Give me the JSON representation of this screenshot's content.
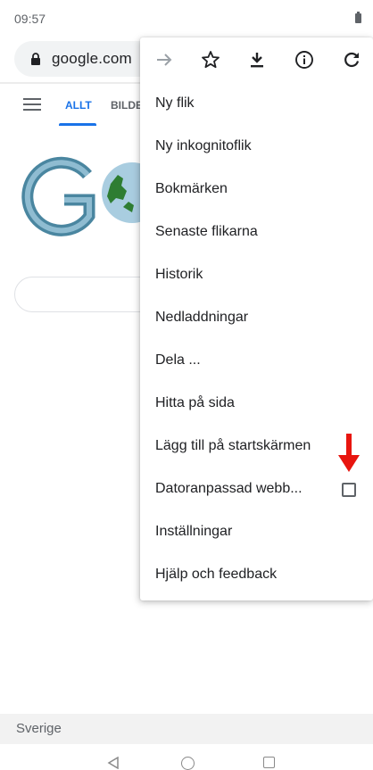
{
  "status_bar": {
    "time": "09:57"
  },
  "url_bar": {
    "url": "google.com"
  },
  "google_page": {
    "tabs": [
      {
        "label": "ALLT",
        "active": true
      },
      {
        "label": "BILDE"
      }
    ],
    "footer_country": "Sverige"
  },
  "overflow_menu": {
    "icon_row": [
      "forward-arrow-icon",
      "star-icon",
      "download-icon",
      "info-icon",
      "refresh-icon"
    ],
    "items": [
      {
        "label": "Ny flik"
      },
      {
        "label": "Ny inkognitoflik"
      },
      {
        "label": "Bokmärken"
      },
      {
        "label": "Senaste flikarna"
      },
      {
        "label": "Historik"
      },
      {
        "label": "Nedladdningar"
      },
      {
        "label": "Dela ..."
      },
      {
        "label": "Hitta på sida"
      },
      {
        "label": "Lägg till på startskärmen"
      },
      {
        "label": "Datoranpassad webb...",
        "checkbox": false
      },
      {
        "label": "Inställningar"
      },
      {
        "label": "Hjälp och feedback"
      }
    ]
  },
  "annotation": {
    "arrow_color": "#e8150f"
  },
  "colors": {
    "accent": "#1a73e8"
  }
}
